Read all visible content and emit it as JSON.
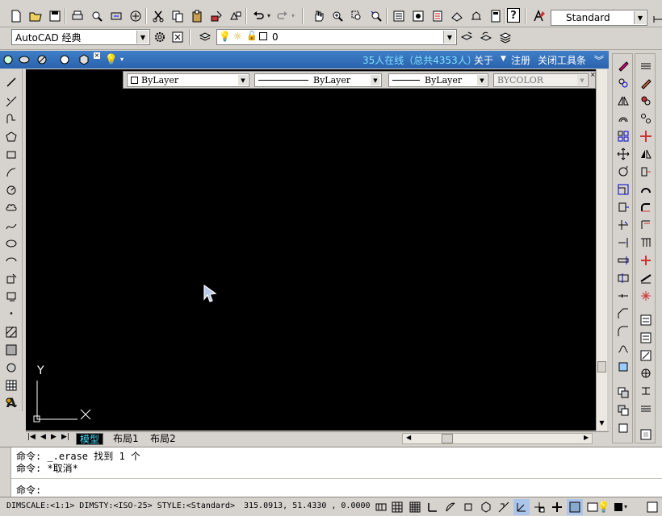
{
  "toolbar1": {
    "textstyle_value": "Standard"
  },
  "toolbar2": {
    "workspace_value": "AutoCAD 经典",
    "layer_value": "0"
  },
  "bluebar": {
    "online_text": "35人在线（总共4353人）",
    "about": "关于",
    "register": "注册",
    "close_toolbar": "关闭工具条"
  },
  "properties": {
    "color": "ByLayer",
    "linetype": "ByLayer",
    "lineweight": "ByLayer",
    "plotstyle": "BYCOLOR"
  },
  "ucs": {
    "y_label": "Y"
  },
  "tabs": [
    "模型",
    "布局1",
    "布局2"
  ],
  "command": {
    "line1": "命令: _.erase 找到 1 个",
    "line2": "命令: *取消*",
    "prompt": "命令:"
  },
  "status": {
    "dim_info": "DIMSCALE:<1:1> DIMSTY:<ISO-25> STYLE:<Standard>",
    "coords": "315.0913, 51.4330 , 0.0000"
  },
  "colors": {
    "canvas": "#000000",
    "ribbon": "#2f6bb8",
    "accent_text": "#7fe3ff"
  }
}
